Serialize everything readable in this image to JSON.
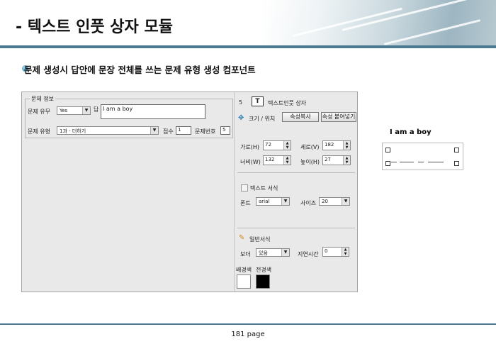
{
  "header": {
    "title": "- 텍스트 인풋 상자 모듈"
  },
  "subtitle": "문제 생성시 답안에 문장 전체를 쓰는 문제 유형 생성 컴포넌트",
  "form": {
    "group_title": "문제 정보",
    "type_label": "문제 유무",
    "type_value": "Yes",
    "answer_label": "답",
    "answer_value": "I am a boy",
    "category_label": "문제 유형",
    "category_value": "1과 - 더하기",
    "score_label": "점수",
    "score_value": "1",
    "qnum_label": "문제번호",
    "qnum_value": "5"
  },
  "props": {
    "index": "5",
    "icon_letter": "T",
    "component_name": "텍스트인풋 상자",
    "size_pos_label": "크기 / 위치",
    "copy_btn": "속성복사",
    "paste_btn": "속성 붙여넣기",
    "width_label": "가로(H)",
    "width_value": "72",
    "height_label": "세로(V)",
    "height_value": "182",
    "w_label": "너비(W)",
    "w_value": "132",
    "h_label": "높이(H)",
    "h_value": "27",
    "text_format_label": "텍스트 서식",
    "font_label": "폰트",
    "font_value": "arial",
    "size_label": "사이즈",
    "size_value": "20",
    "general_label": "일반서식",
    "border_label": "보더",
    "border_value": "있음",
    "delay_label": "지연시간",
    "delay_value": "0",
    "bg_label": "배경색",
    "fg_label": "전경색",
    "bg_color": "#ffffff",
    "fg_color": "#000000"
  },
  "preview": {
    "text": "I am a boy"
  },
  "footer": {
    "page": "181 page"
  },
  "colors": {
    "accent": "#4a7a92"
  }
}
